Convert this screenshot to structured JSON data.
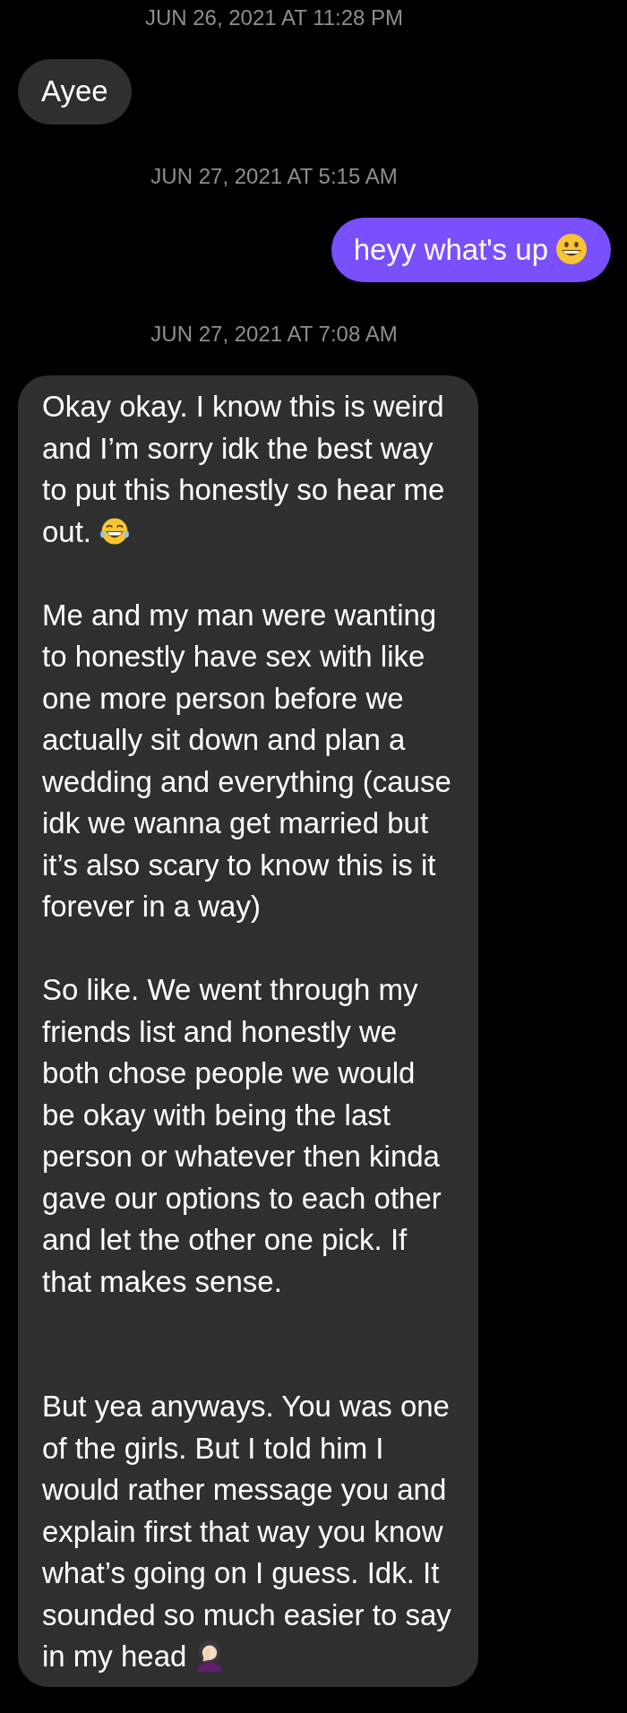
{
  "thread": [
    {
      "kind": "timestamp",
      "text": "JUN 26, 2021 AT 11:28 PM"
    },
    {
      "kind": "received",
      "paragraphs": [
        {
          "kind": "first",
          "lines": [
            "Ayee"
          ]
        }
      ]
    },
    {
      "kind": "timestamp",
      "text": "JUN 27, 2021 AT 5:15 AM"
    },
    {
      "kind": "sent",
      "paragraphs": [
        {
          "kind": "first",
          "lines": [
            "heyy what's up"
          ],
          "trailing_icon": {
            "kind": "grin"
          }
        }
      ]
    },
    {
      "kind": "timestamp",
      "text": "JUN 27, 2021 AT 7:08 AM"
    },
    {
      "kind": "received",
      "paragraphs": [
        {
          "kind": "first",
          "lines": [
            "Okay okay. I know this is weird",
            "and I’m sorry idk the best way",
            "to put this honestly so hear me",
            "out."
          ],
          "trailing_icon": {
            "kind": "laugh-tears"
          }
        },
        {
          "kind": "after-gap",
          "lines": [
            "Me and my man were wanting",
            "to honestly have sex with like",
            "one more person before we",
            "actually sit down and plan a",
            "wedding and everything (cause",
            "idk we wanna get married but",
            "it’s also scary to know this is it",
            "forever in a way)"
          ]
        },
        {
          "kind": "after-gap",
          "lines": [
            "So like. We went through my",
            "friends list and honestly we",
            "both chose people we would",
            "be okay with being the last",
            "person or whatever then kinda",
            "gave our options to each other",
            "and let the other one pick. If",
            "that makes sense."
          ]
        },
        {
          "kind": "after-double-gap",
          "lines": [
            "But yea anyways. You was one",
            "of the girls. But I told him I",
            "would rather message you and",
            "explain first that way you know",
            "what’s going on I guess. Idk. It",
            "sounded so much easier to say",
            "in my head"
          ],
          "trailing_icon": {
            "kind": "facepalm-figure"
          }
        }
      ]
    }
  ]
}
